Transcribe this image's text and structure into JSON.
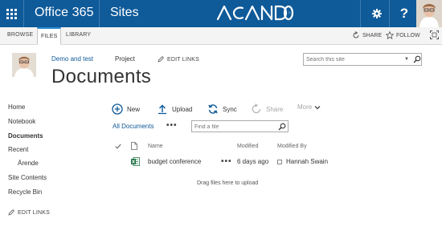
{
  "suite_bar": {
    "app_name": "Office 365",
    "section": "Sites",
    "help_label": "?",
    "icons": {
      "app_launcher": "waffle-icon",
      "settings": "gear-icon",
      "help": "help-icon",
      "profile": "avatar",
      "logo": "acando-logo"
    },
    "colors": {
      "bar": "#0f5a99"
    }
  },
  "ribbon": {
    "tabs": [
      {
        "label": "BROWSE",
        "active": false
      },
      {
        "label": "FILES",
        "active": true
      },
      {
        "label": "LIBRARY",
        "active": false
      }
    ],
    "share_label": "SHARE",
    "follow_label": "FOLLOW",
    "icons": {
      "share": "share-icon",
      "follow": "star-icon",
      "focus": "focus-icon"
    }
  },
  "site_header": {
    "links": [
      {
        "label": "Demo and test",
        "active": true
      },
      {
        "label": "Project",
        "active": false
      }
    ],
    "edit_links_label": "EDIT LINKS",
    "page_title": "Documents",
    "search": {
      "placeholder": "Search this site"
    }
  },
  "quick_launch": {
    "items": [
      {
        "label": "Home",
        "current": false
      },
      {
        "label": "Notebook",
        "current": false
      },
      {
        "label": "Documents",
        "current": true
      },
      {
        "label": "Recent",
        "current": false
      },
      {
        "label": "Ärende",
        "current": false,
        "sub": true
      },
      {
        "label": "Site Contents",
        "current": false
      },
      {
        "label": "Recycle Bin",
        "current": false
      }
    ],
    "edit_links_label": "EDIT LINKS"
  },
  "command_bar": {
    "new_label": "New",
    "upload_label": "Upload",
    "sync_label": "Sync",
    "share_label": "Share",
    "more_label": "More",
    "icons": {
      "new": "plus-circle-icon",
      "upload": "upload-icon",
      "sync": "sync-icon",
      "share": "share-icon",
      "more": "chevron-down-icon"
    },
    "accent": "#0f5a99"
  },
  "view": {
    "current_view_label": "All Documents",
    "ellipsis": "•••",
    "find_placeholder": "Find a file"
  },
  "list": {
    "columns": {
      "name": "Name",
      "modified": "Modified",
      "modified_by": "Modified By"
    },
    "rows": [
      {
        "name": "budget conference",
        "modified": "6 days ago",
        "modified_by": "Hannah Swain",
        "file_icon": "excel-file-icon",
        "ellipsis": "•••"
      }
    ],
    "drop_message": "Drag files here to upload"
  }
}
